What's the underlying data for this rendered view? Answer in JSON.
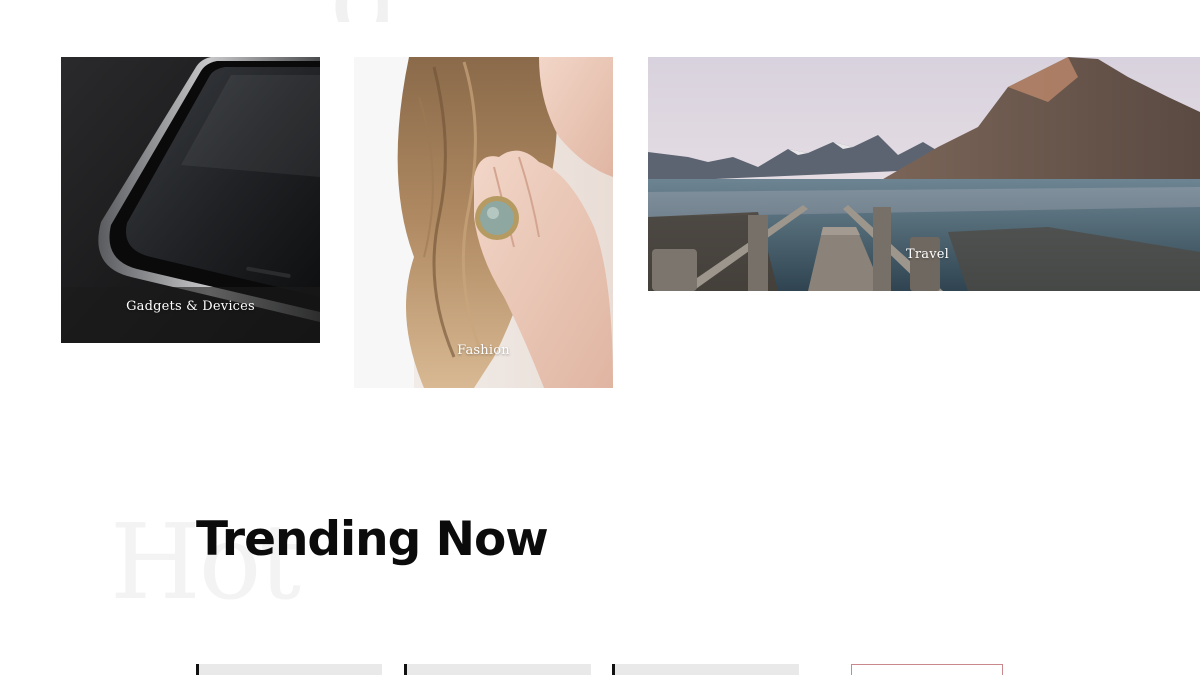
{
  "categories": [
    {
      "id": "gadgets",
      "label": "Gadgets & Devices",
      "image": "smartphone-edge-photo"
    },
    {
      "id": "fashion",
      "label": "Fashion",
      "image": "hand-with-ring-photo"
    },
    {
      "id": "travel",
      "label": "Travel",
      "image": "mountain-lake-pier-photo"
    }
  ],
  "trending": {
    "title": "Trending Now",
    "watermark": "Hot"
  }
}
